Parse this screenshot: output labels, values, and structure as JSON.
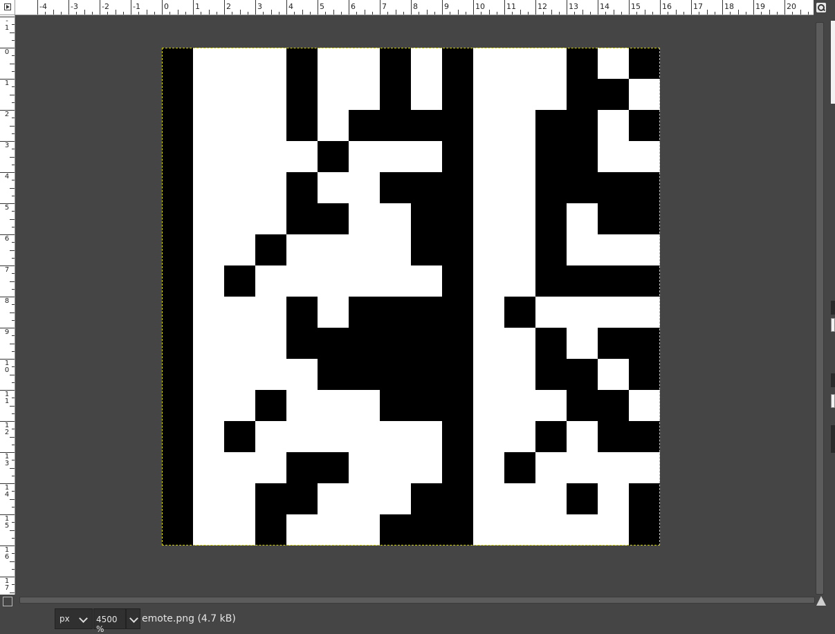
{
  "rulers": {
    "horizontal": [
      "-4",
      "-3",
      "-2",
      "-1",
      "0",
      "1",
      "2",
      "3",
      "4",
      "5",
      "6",
      "7",
      "8",
      "9",
      "10",
      "11",
      "12",
      "13",
      "14",
      "15",
      "16",
      "17",
      "18",
      "19",
      "20"
    ],
    "vertical": [
      "-1",
      "0",
      "1",
      "2",
      "3",
      "4",
      "5",
      "6",
      "7",
      "8",
      "9",
      "10",
      "11",
      "12",
      "13",
      "14",
      "15",
      "16",
      "17"
    ]
  },
  "image": {
    "rows": [
      "1000100101000101",
      "1000100101000110",
      "1000101111001101",
      "1000010001001100",
      "1000100111001111",
      "1000110011001011",
      "1001000011001000",
      "1010000001001111",
      "1000101111010000",
      "1000111111001011",
      "1000011111001101",
      "1001000111000110",
      "1010000001001011",
      "1000110001010000",
      "1001100011000101",
      "1001000111000001"
    ],
    "pixel_color": "#000000",
    "background_color": "#ffffff",
    "boundary_color": "#d8d800"
  },
  "statusbar": {
    "unit": "px",
    "zoom": "4500 %",
    "file_info": "emote.png (4.7 kB)"
  },
  "icons": {
    "ruler_corner": "quick-mask-toggle-icon",
    "zoom": "zoom-image-icon",
    "navigate": "navigate-icon"
  }
}
